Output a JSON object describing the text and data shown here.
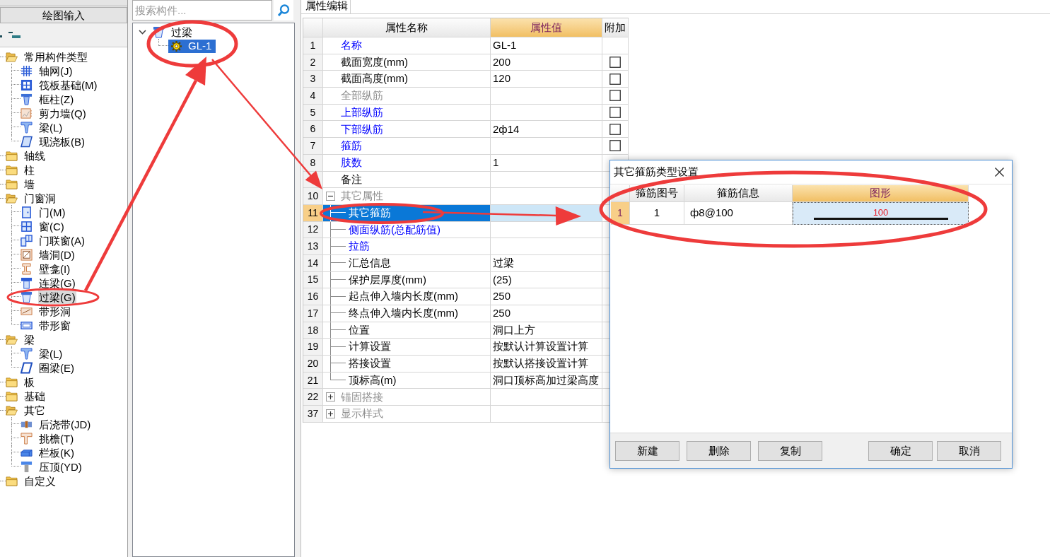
{
  "left_panel": {
    "mode_button": "绘图输入",
    "tree": [
      {
        "label": "常用构件类型",
        "kind": "folder",
        "expanded": true,
        "selected": false,
        "children": [
          {
            "label": "轴网(J)",
            "kind": "grid",
            "selected": false
          },
          {
            "label": "筏板基础(M)",
            "kind": "raft",
            "selected": false
          },
          {
            "label": "框柱(Z)",
            "kind": "column",
            "selected": false
          },
          {
            "label": "剪力墙(Q)",
            "kind": "wall",
            "selected": false
          },
          {
            "label": "梁(L)",
            "kind": "beam",
            "selected": false
          },
          {
            "label": "现浇板(B)",
            "kind": "slab",
            "selected": false
          }
        ]
      },
      {
        "label": "轴线",
        "kind": "folder",
        "expanded": false,
        "selected": false
      },
      {
        "label": "柱",
        "kind": "folder",
        "expanded": false,
        "selected": false
      },
      {
        "label": "墙",
        "kind": "folder",
        "expanded": false,
        "selected": false
      },
      {
        "label": "门窗洞",
        "kind": "folder",
        "expanded": true,
        "selected": false,
        "children": [
          {
            "label": "门(M)",
            "kind": "door",
            "selected": false
          },
          {
            "label": "窗(C)",
            "kind": "window",
            "selected": false
          },
          {
            "label": "门联窗(A)",
            "kind": "door_window",
            "selected": false
          },
          {
            "label": "墙洞(D)",
            "kind": "opening",
            "selected": false
          },
          {
            "label": "壁龛(I)",
            "kind": "niche",
            "selected": false
          },
          {
            "label": "连梁(G)",
            "kind": "coupling_beam",
            "selected": false
          },
          {
            "label": "过梁(G)",
            "kind": "lintel",
            "selected": true
          },
          {
            "label": "带形洞",
            "kind": "strip_opening",
            "selected": false
          },
          {
            "label": "带形窗",
            "kind": "strip_window",
            "selected": false
          }
        ]
      },
      {
        "label": "梁",
        "kind": "folder",
        "expanded": true,
        "selected": false,
        "children": [
          {
            "label": "梁(L)",
            "kind": "beam",
            "selected": false
          },
          {
            "label": "圈梁(E)",
            "kind": "ring_beam",
            "selected": false
          }
        ]
      },
      {
        "label": "板",
        "kind": "folder",
        "expanded": false,
        "selected": false
      },
      {
        "label": "基础",
        "kind": "folder",
        "expanded": false,
        "selected": false
      },
      {
        "label": "其它",
        "kind": "folder",
        "expanded": true,
        "selected": false,
        "children": [
          {
            "label": "后浇带(JD)",
            "kind": "post_pour",
            "selected": false
          },
          {
            "label": "挑檐(T)",
            "kind": "eave",
            "selected": false
          },
          {
            "label": "栏板(K)",
            "kind": "parapet",
            "selected": false
          },
          {
            "label": "压顶(YD)",
            "kind": "coping",
            "selected": false
          }
        ]
      },
      {
        "label": "自定义",
        "kind": "folder",
        "expanded": false,
        "selected": false
      }
    ]
  },
  "component_panel": {
    "search": {
      "placeholder": "搜索构件..."
    },
    "tree": [
      {
        "label": "过梁",
        "kind": "lintel",
        "expanded": true,
        "selected": false,
        "children": [
          {
            "label": "GL-1",
            "kind": "component",
            "selected": true
          }
        ]
      }
    ]
  },
  "property_panel": {
    "tab": "属性编辑",
    "columns": [
      {
        "label": "属性名称",
        "selected": false
      },
      {
        "label": "属性值",
        "selected": true
      },
      {
        "label": "附加",
        "selected": false
      }
    ],
    "rows": [
      {
        "number": "1",
        "name": "名称",
        "value": "GL-1",
        "kind": "link",
        "selected": false
      },
      {
        "number": "2",
        "name": "截面宽度(mm)",
        "value": "200",
        "kind": "plain",
        "selected": false,
        "checked": false
      },
      {
        "number": "3",
        "name": "截面高度(mm)",
        "value": "120",
        "kind": "plain",
        "selected": false,
        "checked": false
      },
      {
        "number": "4",
        "name": "全部纵筋",
        "kind": "disabled",
        "selected": false,
        "checked": false
      },
      {
        "number": "5",
        "name": "上部纵筋",
        "kind": "link",
        "selected": false,
        "checked": false
      },
      {
        "number": "6",
        "name": "下部纵筋",
        "value": "2ф14",
        "kind": "link",
        "selected": false,
        "checked": false
      },
      {
        "number": "7",
        "name": "箍筋",
        "kind": "link",
        "selected": false,
        "checked": false
      },
      {
        "number": "8",
        "name": "肢数",
        "value": "1",
        "kind": "link",
        "selected": false
      },
      {
        "name": "备注",
        "kind": "plain",
        "selected": false
      },
      {
        "number": "10",
        "name": "其它属性",
        "kind": "group",
        "expanded": true,
        "selected": false,
        "children": [
          {
            "number": "11",
            "name": "其它箍筋",
            "kind": "plain",
            "selected": true
          },
          {
            "number": "12",
            "name": "侧面纵筋(总配筋值)",
            "kind": "link",
            "selected": false
          },
          {
            "number": "13",
            "name": "拉筋",
            "kind": "link",
            "selected": false
          },
          {
            "number": "14",
            "name": "汇总信息",
            "value": "过梁",
            "kind": "plain",
            "selected": false
          },
          {
            "number": "15",
            "name": "保护层厚度(mm)",
            "value": "(25)",
            "kind": "plain",
            "selected": false
          },
          {
            "number": "16",
            "name": "起点伸入墙内长度(mm)",
            "value": "250",
            "kind": "plain",
            "selected": false
          },
          {
            "number": "17",
            "name": "终点伸入墙内长度(mm)",
            "value": "250",
            "kind": "plain",
            "selected": false
          },
          {
            "number": "18",
            "name": "位置",
            "value": "洞口上方",
            "kind": "plain",
            "selected": false
          },
          {
            "number": "19",
            "name": "计算设置",
            "value": "按默认计算设置计算",
            "kind": "plain",
            "selected": false
          },
          {
            "number": "20",
            "name": "搭接设置",
            "value": "按默认搭接设置计算",
            "kind": "plain",
            "selected": false
          },
          {
            "number": "21",
            "name": "顶标高(m)",
            "value": "洞口顶标高加过梁高度",
            "kind": "plain",
            "selected": false
          }
        ]
      },
      {
        "number": "22",
        "name": "锚固搭接",
        "kind": "group",
        "expanded": false,
        "selected": false
      },
      {
        "number": "37",
        "name": "显示样式",
        "kind": "group",
        "expanded": false,
        "selected": false
      }
    ]
  },
  "dialog": {
    "title": "其它箍筋类型设置",
    "columns": [
      {
        "label": "箍筋图号",
        "selected": false
      },
      {
        "label": "箍筋信息",
        "selected": false
      },
      {
        "label": "图形",
        "selected": true
      }
    ],
    "rows": [
      {
        "number": "1",
        "figure_no": "1",
        "info": "ф8@100",
        "shape_label": "100",
        "selected": true
      }
    ],
    "left_buttons": [
      "新建",
      "删除",
      "复制"
    ],
    "right_buttons": [
      "确定",
      "取消"
    ]
  }
}
